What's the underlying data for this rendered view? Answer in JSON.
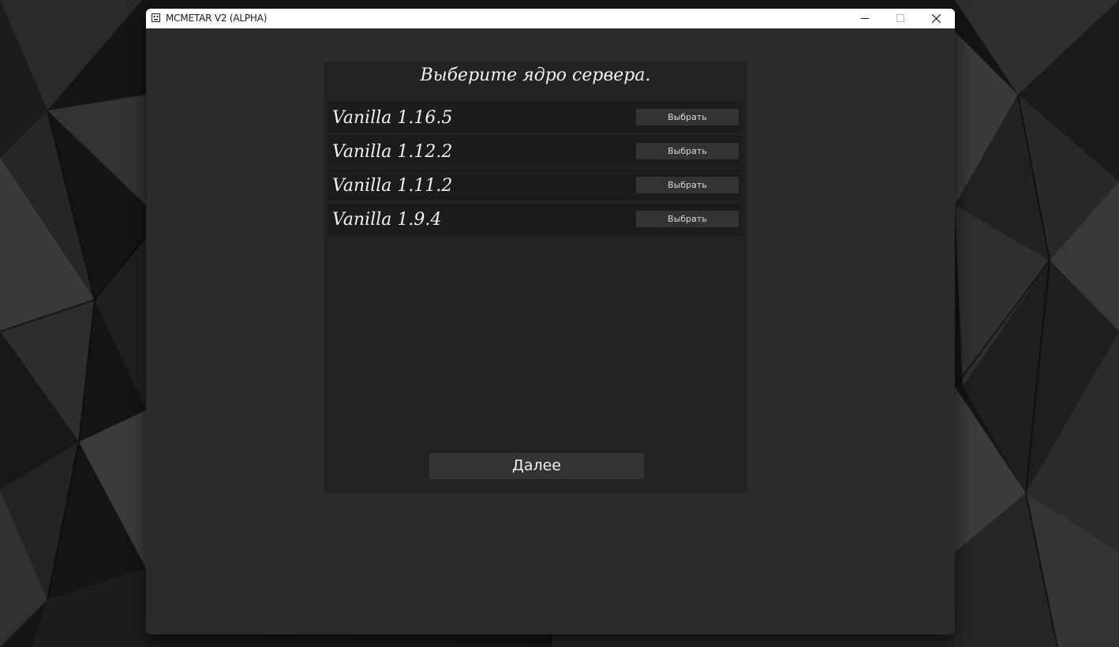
{
  "window": {
    "title": "MCMETAR V2 (ALPHA)"
  },
  "panel": {
    "title": "Выберите ядро сервера.",
    "cores": [
      {
        "label": "Vanilla 1.16.5",
        "button": "Выбрать"
      },
      {
        "label": "Vanilla 1.12.2",
        "button": "Выбрать"
      },
      {
        "label": "Vanilla 1.11.2",
        "button": "Выбрать"
      },
      {
        "label": "Vanilla 1.9.4",
        "button": "Выбрать"
      }
    ],
    "next_label": "Далее"
  },
  "icons": {
    "app": "app-icon",
    "minimize": "minimize-icon",
    "maximize": "maximize-icon",
    "close": "close-icon"
  },
  "colors": {
    "window_bg": "#2b2b2b",
    "panel_bg": "#232323",
    "row_bg": "#1c1c1c",
    "button_bg": "#333333",
    "text": "#f0f0f0"
  }
}
